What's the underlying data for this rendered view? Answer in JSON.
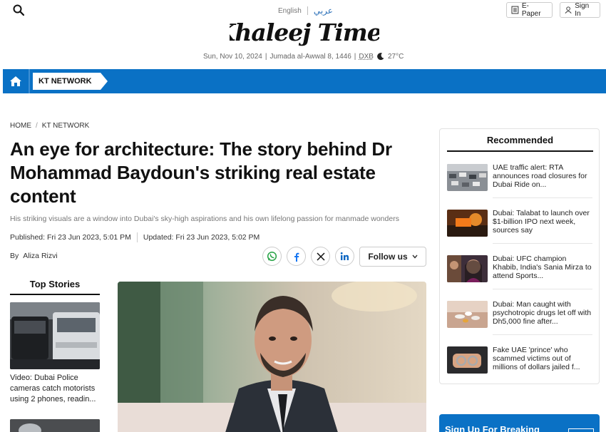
{
  "header": {
    "lang_en": "English",
    "lang_ar": "عربي",
    "logo_text": "Khaleej Times",
    "date": "Sun, Nov 10, 2024",
    "hijri": "Jumada al-Awwal 8, 1446",
    "location": "DXB",
    "temperature": "27°C",
    "epaper_label": "E-Paper",
    "signin_label": "Sign In"
  },
  "nav": {
    "tab_label": "KT NETWORK"
  },
  "breadcrumb": {
    "home": "HOME",
    "section": "KT NETWORK"
  },
  "article": {
    "headline": "An eye for architecture: The story behind Dr Mohammad Baydoun's striking real estate content",
    "standfirst": "His striking visuals are a window into Dubai's sky-high aspirations and his own lifelong passion for manmade wonders",
    "published": "Published: Fri 23 Jun 2023, 5:01 PM",
    "updated": "Updated: Fri 23 Jun 2023, 5:02 PM",
    "by": "By",
    "author": "Aliza Rizvi",
    "follow_label": "Follow us"
  },
  "top_stories": {
    "title": "Top Stories",
    "items": [
      {
        "text": "Video: Dubai Police cameras catch motorists using 2 phones, readin..."
      }
    ]
  },
  "recommended": {
    "title": "Recommended",
    "items": [
      {
        "text": "UAE traffic alert: RTA announces road closures for Dubai Ride on..."
      },
      {
        "text": "Dubai: Talabat to launch over $1-billion IPO next week, sources say"
      },
      {
        "text": "Dubai: UFC champion Khabib, India's Sania Mirza to attend Sports..."
      },
      {
        "text": "Dubai: Man caught with psychotropic drugs let off with Dh5,000 fine after..."
      },
      {
        "text": "Fake UAE 'prince' who scammed victims out of millions of dollars jailed f..."
      }
    ]
  },
  "signup": {
    "label": "Sign Up For Breaking"
  },
  "colors": {
    "brand_blue": "#0a71c5",
    "link_blue": "#2a6fb8"
  }
}
